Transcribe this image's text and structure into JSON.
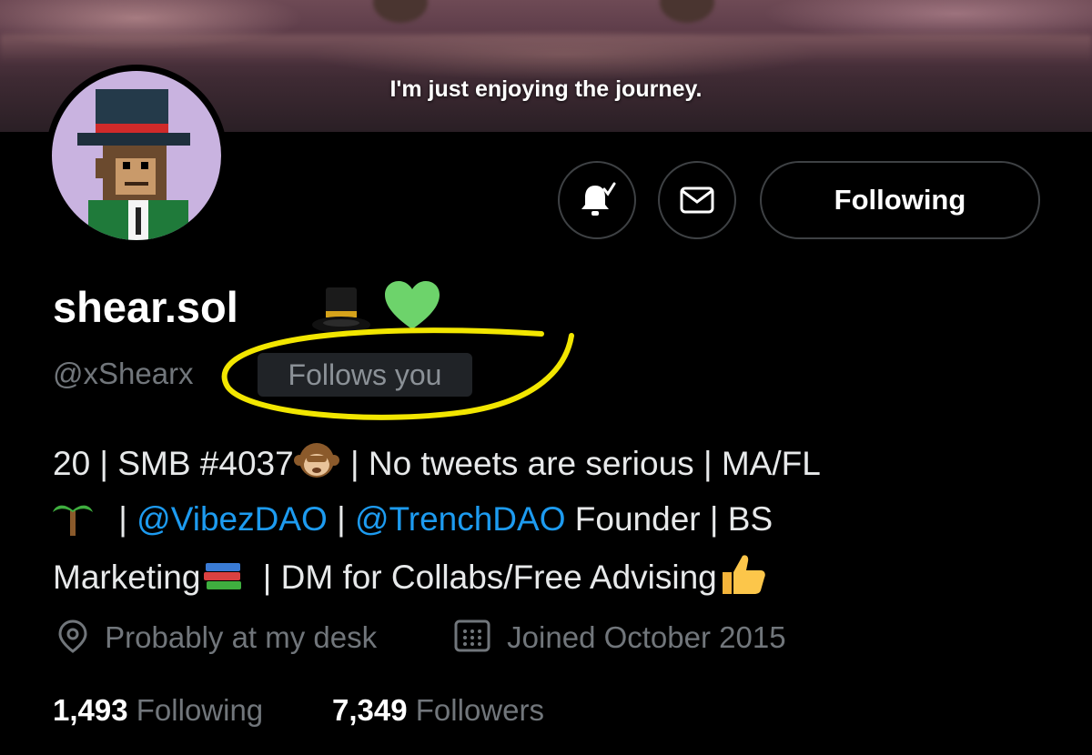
{
  "banner": {
    "caption": "I'm just enjoying the journey."
  },
  "profile": {
    "display_name": "shear.sol",
    "handle": "@xShearx",
    "follows_you": "Follows you",
    "name_emojis": [
      "top-hat-emoji",
      "green-heart-emoji"
    ]
  },
  "actions": {
    "notifications_icon": "bell-check-icon",
    "message_icon": "envelope-icon",
    "follow_label": "Following"
  },
  "bio": {
    "line1_a": "20 | SMB #4037",
    "line1_b": " | No tweets are serious | MA/FL",
    "line2_a": " | ",
    "line2_link1": "@VibezDAO",
    "line2_b": " | ",
    "line2_link2": "@TrenchDAO",
    "line2_c": " Founder | BS",
    "line3_a": "Marketing",
    "line3_b": " | DM for Collabs/Free Advising"
  },
  "meta": {
    "location": "Probably at my desk",
    "joined": "Joined October 2015"
  },
  "stats": {
    "following_count": "1,493",
    "following_label": "Following",
    "followers_count": "7,349",
    "followers_label": "Followers"
  },
  "colors": {
    "link": "#1d9bf0",
    "highlight_annotation": "#f2e600",
    "verified_heart": "#6dd36b"
  }
}
